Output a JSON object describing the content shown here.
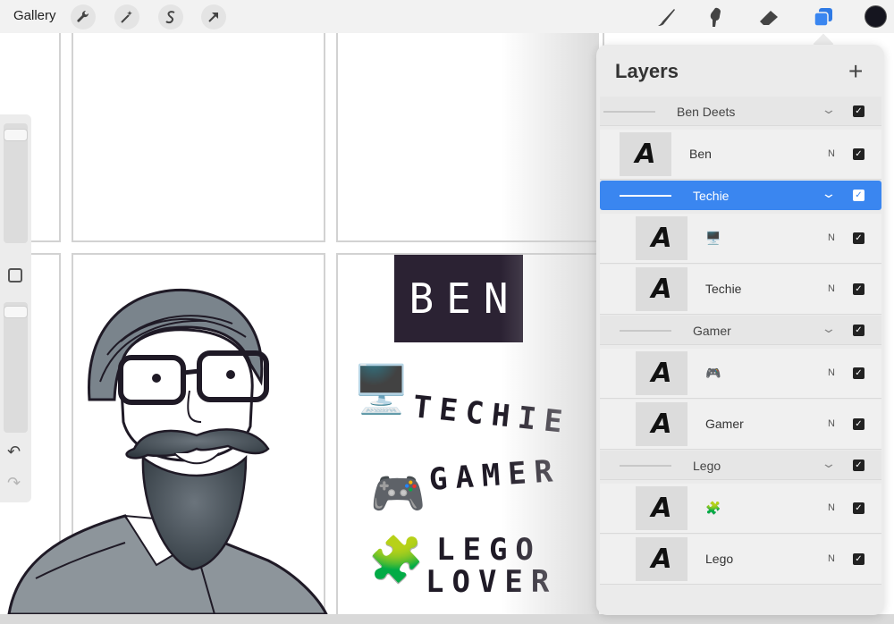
{
  "toolbar": {
    "gallery_label": "Gallery",
    "left_tools": [
      "wrench-icon",
      "magic-wand-icon",
      "selection-s-icon",
      "arrow-icon"
    ],
    "right_tools": [
      "brush-icon",
      "smudge-icon",
      "eraser-icon",
      "layers-icon"
    ],
    "active_color": "#15151f",
    "accent_color": "#3a86f0"
  },
  "canvas": {
    "ben_label": "BEN",
    "words": {
      "techie": "TECHIE",
      "gamer": "GAMER",
      "lego": "LEGO",
      "lover": "LOVER"
    },
    "emoji": {
      "computer": "🖥️",
      "gamepad": "🎮",
      "puzzle": "🧩"
    }
  },
  "sidebar": {
    "undo": "↶",
    "redo": "↷"
  },
  "layers": {
    "title": "Layers",
    "add": "+",
    "rows": [
      {
        "type": "group",
        "name": "Ben Deets",
        "checked": true,
        "selected": false,
        "indent": 0
      },
      {
        "type": "layer",
        "name": "Ben",
        "blend": "N",
        "thumb": "A",
        "indent": 0
      },
      {
        "type": "group",
        "name": "Techie",
        "checked": true,
        "selected": true,
        "indent": 1
      },
      {
        "type": "layer",
        "name": "🖥️",
        "blend": "N",
        "thumb": "A",
        "indent": 1
      },
      {
        "type": "layer",
        "name": "Techie",
        "blend": "N",
        "thumb": "A",
        "indent": 1
      },
      {
        "type": "group",
        "name": "Gamer",
        "checked": true,
        "selected": false,
        "indent": 1
      },
      {
        "type": "layer",
        "name": "🎮",
        "blend": "N",
        "thumb": "A",
        "indent": 1
      },
      {
        "type": "layer",
        "name": "Gamer",
        "blend": "N",
        "thumb": "A",
        "indent": 1
      },
      {
        "type": "group",
        "name": "Lego",
        "checked": true,
        "selected": false,
        "indent": 1
      },
      {
        "type": "layer",
        "name": "🧩",
        "blend": "N",
        "thumb": "A",
        "indent": 1
      },
      {
        "type": "layer",
        "name": "Lego",
        "blend": "N",
        "thumb": "A",
        "indent": 1
      }
    ]
  }
}
